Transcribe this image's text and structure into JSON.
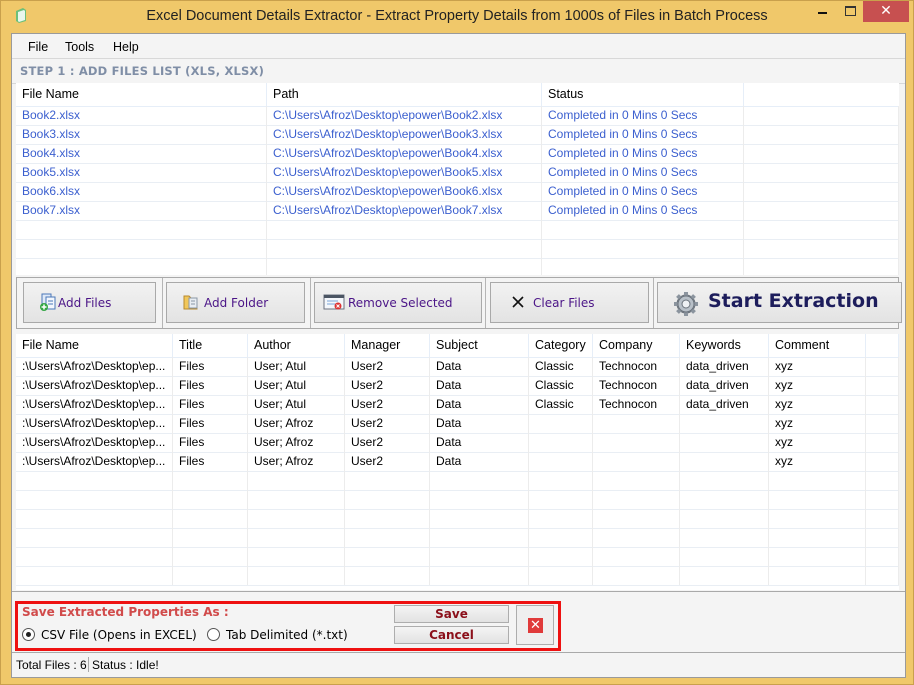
{
  "window": {
    "title": "Excel Document Details Extractor - Extract Property Details from 1000s of Files in Batch Process",
    "minimize_label": "",
    "close_label": "✕"
  },
  "menu": [
    {
      "label": "File"
    },
    {
      "label": "Tools"
    },
    {
      "label": "Help"
    }
  ],
  "step1": {
    "label": "STEP 1 : ADD FILES LIST (XLS, XLSX)"
  },
  "files_table": {
    "columns": [
      "File Name",
      "Path",
      "Status",
      ""
    ],
    "rows": [
      [
        "Book2.xlsx",
        "C:\\Users\\Afroz\\Desktop\\epower\\Book2.xlsx",
        "Completed in 0 Mins 0 Secs"
      ],
      [
        "Book3.xlsx",
        "C:\\Users\\Afroz\\Desktop\\epower\\Book3.xlsx",
        "Completed in 0 Mins 0 Secs"
      ],
      [
        "Book4.xlsx",
        "C:\\Users\\Afroz\\Desktop\\epower\\Book4.xlsx",
        "Completed in 0 Mins 0 Secs"
      ],
      [
        "Book5.xlsx",
        "C:\\Users\\Afroz\\Desktop\\epower\\Book5.xlsx",
        "Completed in 0 Mins 0 Secs"
      ],
      [
        "Book6.xlsx",
        "C:\\Users\\Afroz\\Desktop\\epower\\Book6.xlsx",
        "Completed in 0 Mins 0 Secs"
      ],
      [
        "Book7.xlsx",
        "C:\\Users\\Afroz\\Desktop\\epower\\Book7.xlsx",
        "Completed in 0 Mins 0 Secs"
      ]
    ]
  },
  "toolbar": {
    "add_files": {
      "label": "Add Files",
      "icon": "add-files-icon"
    },
    "add_folder": {
      "label": "Add Folder",
      "icon": "folder-icon"
    },
    "remove_selected": {
      "label": "Remove Selected",
      "icon": "remove-list-icon"
    },
    "clear_files": {
      "label": "Clear Files",
      "icon": "x-icon"
    },
    "start_extraction": {
      "label": "Start Extraction",
      "icon": "gear-icon"
    }
  },
  "properties_table": {
    "columns": [
      "File Name",
      "Title",
      "Author",
      "Manager",
      "Subject",
      "Category",
      "Company",
      "Keywords",
      "Comment",
      ""
    ],
    "rows": [
      [
        ":\\Users\\Afroz\\Desktop\\ep...",
        "Files",
        "User; Atul",
        "User2",
        "Data",
        "Classic",
        "Technocon",
        "data_driven",
        "xyz"
      ],
      [
        ":\\Users\\Afroz\\Desktop\\ep...",
        "Files",
        "User; Atul",
        "User2",
        "Data",
        "Classic",
        "Technocon",
        "data_driven",
        "xyz"
      ],
      [
        ":\\Users\\Afroz\\Desktop\\ep...",
        "Files",
        "User; Atul",
        "User2",
        "Data",
        "Classic",
        "Technocon",
        "data_driven",
        "xyz"
      ],
      [
        ":\\Users\\Afroz\\Desktop\\ep...",
        "Files",
        "User; Afroz",
        "User2",
        "Data",
        "",
        "",
        "",
        "xyz"
      ],
      [
        ":\\Users\\Afroz\\Desktop\\ep...",
        "Files",
        "User; Afroz",
        "User2",
        "Data",
        "",
        "",
        "",
        "xyz"
      ],
      [
        ":\\Users\\Afroz\\Desktop\\ep...",
        "Files",
        "User; Afroz",
        "User2",
        "Data",
        "",
        "",
        "",
        "xyz"
      ]
    ]
  },
  "save_panel": {
    "title": "Save Extracted Properties As :",
    "options": [
      {
        "label": "CSV File (Opens in EXCEL)",
        "selected": true
      },
      {
        "label": "Tab Delimited (*.txt)",
        "selected": false
      }
    ],
    "save_label": "Save",
    "cancel_label": "Cancel",
    "close_label": "✕"
  },
  "status_bar": {
    "total_files": "Total Files : 6",
    "status": "Status :   Idle!"
  },
  "colors": {
    "window_frame": "#f0c86a",
    "close_button": "#c75050",
    "link_text": "#3b5fcf",
    "step_label": "#7f8ea6",
    "save_title": "#d14b4b",
    "highlight_box": "#ee1111",
    "save_button_text": "#8b0f1a"
  }
}
